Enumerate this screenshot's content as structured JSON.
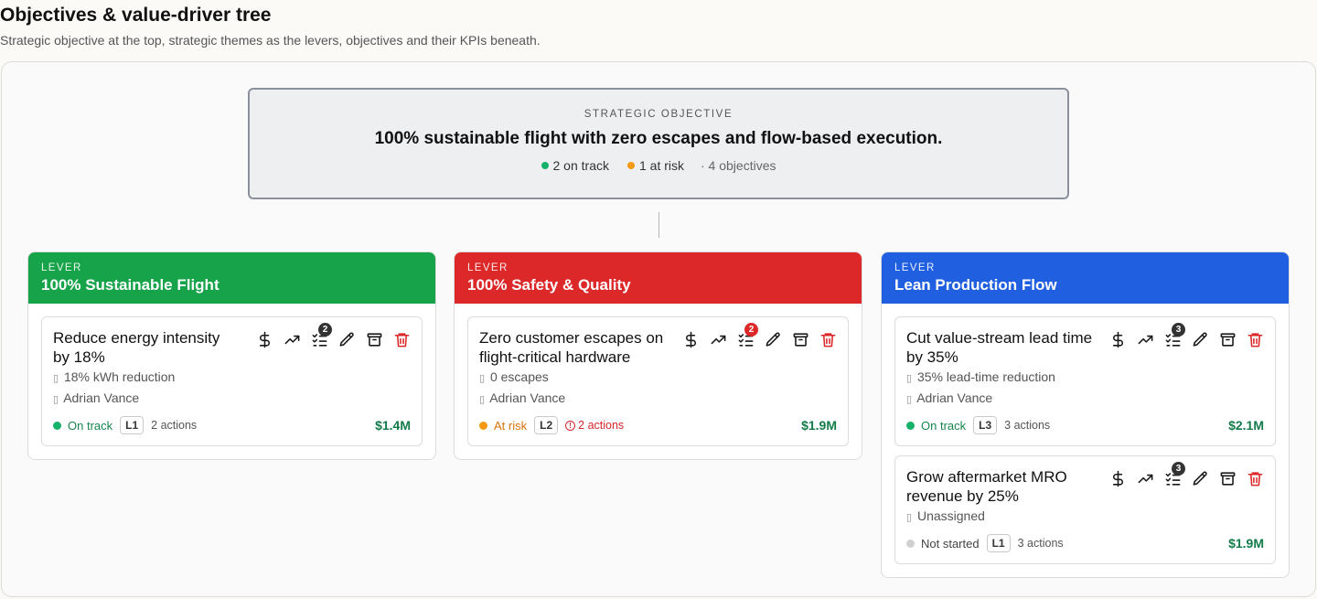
{
  "header": {
    "title": "Objectives & value-driver tree",
    "subtitle": "Strategic objective at the top, strategic themes as the levers, objectives and their KPIs beneath."
  },
  "objective": {
    "eyebrow": "STRATEGIC OBJECTIVE",
    "title": "100% sustainable flight with zero escapes and flow-based execution.",
    "on_track": "2 on track",
    "at_risk": "1 at risk",
    "objectives_count": "· 4 objectives"
  },
  "colors": {
    "green": "#17a34a",
    "red": "#dc2828",
    "blue": "#1f5fe0",
    "on_track": "#17b26a",
    "at_risk": "#f59a12",
    "not_started": "#d0d0d0",
    "value": "#137a49"
  },
  "icons": [
    "dollar-icon",
    "trend-up-icon",
    "checklist-icon",
    "pencil-icon",
    "archive-icon",
    "trash-icon"
  ],
  "levers": [
    {
      "eyebrow": "LEVER",
      "name": "100% Sustainable Flight",
      "color": "#17a34a",
      "cards": [
        {
          "title": "Reduce energy intensity by 18%",
          "kpi": "18% kWh reduction",
          "owner": "Adrian Vance",
          "status": "On track",
          "status_color": "#17b26a",
          "status_text_color": "#17864d",
          "level": "L1",
          "actions": "2 actions",
          "actions_warn": false,
          "value": "$1.4M",
          "badge": "2",
          "badge_color": "#333333"
        }
      ]
    },
    {
      "eyebrow": "LEVER",
      "name": "100% Safety & Quality",
      "color": "#dc2828",
      "cards": [
        {
          "title": "Zero customer escapes on flight-critical hardware",
          "kpi": "0 escapes",
          "owner": "Adrian Vance",
          "status": "At risk",
          "status_color": "#f59a12",
          "status_text_color": "#d9720b",
          "level": "L2",
          "actions": "2 actions",
          "actions_warn": true,
          "value": "$1.9M",
          "badge": "2",
          "badge_color": "#dc2828"
        }
      ]
    },
    {
      "eyebrow": "LEVER",
      "name": "Lean Production Flow",
      "color": "#1f5fe0",
      "cards": [
        {
          "title": "Cut value-stream lead time by 35%",
          "kpi": "35% lead-time reduction",
          "owner": "Adrian Vance",
          "status": "On track",
          "status_color": "#17b26a",
          "status_text_color": "#17864d",
          "level": "L3",
          "actions": "3 actions",
          "actions_warn": false,
          "value": "$2.1M",
          "badge": "3",
          "badge_color": "#333333"
        },
        {
          "title": "Grow aftermarket MRO revenue by 25%",
          "kpi": "",
          "owner": "Unassigned",
          "status": "Not started",
          "status_color": "#d0d0d0",
          "status_text_color": "#444444",
          "level": "L1",
          "actions": "3 actions",
          "actions_warn": false,
          "value": "$1.9M",
          "badge": "3",
          "badge_color": "#333333"
        }
      ]
    }
  ]
}
